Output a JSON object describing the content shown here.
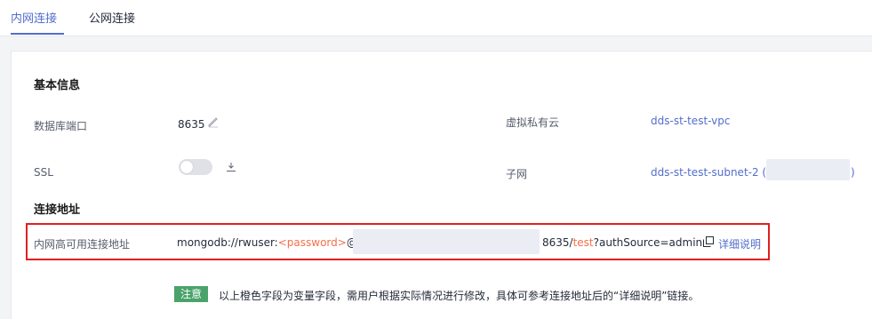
{
  "tabs": [
    {
      "label": "内网连接",
      "active": true
    },
    {
      "label": "公网连接",
      "active": false
    }
  ],
  "basic": {
    "title": "基本信息",
    "port_label": "数据库端口",
    "port_value": "8635",
    "vpc_label": "虚拟私有云",
    "vpc_value": "dds-st-test-vpc",
    "ssl_label": "SSL",
    "ssl_enabled": false,
    "subnet_label": "子网",
    "subnet_value": "dds-st-test-subnet-2 (",
    "subnet_suffix": ")"
  },
  "connection": {
    "title": "连接地址",
    "label": "内网高可用连接地址",
    "prefix": "mongodb://rwuser:",
    "password_placeholder": "<password>",
    "at": "@",
    "port_part": "8635/",
    "db_placeholder": "test",
    "suffix": "?authSource=admin",
    "details_link": "详细说明"
  },
  "note": {
    "badge": "注意",
    "text": "以上橙色字段为变量字段，需用户根据实际情况进行修改，具体可参考连接地址后的“详细说明”链接。"
  },
  "colors": {
    "accent": "#526ecc",
    "highlight_border": "#e02020",
    "variable_orange": "#f66f4b",
    "note_green": "#4aa36a"
  },
  "icons": [
    "edit-icon",
    "download-icon",
    "copy-icon"
  ]
}
